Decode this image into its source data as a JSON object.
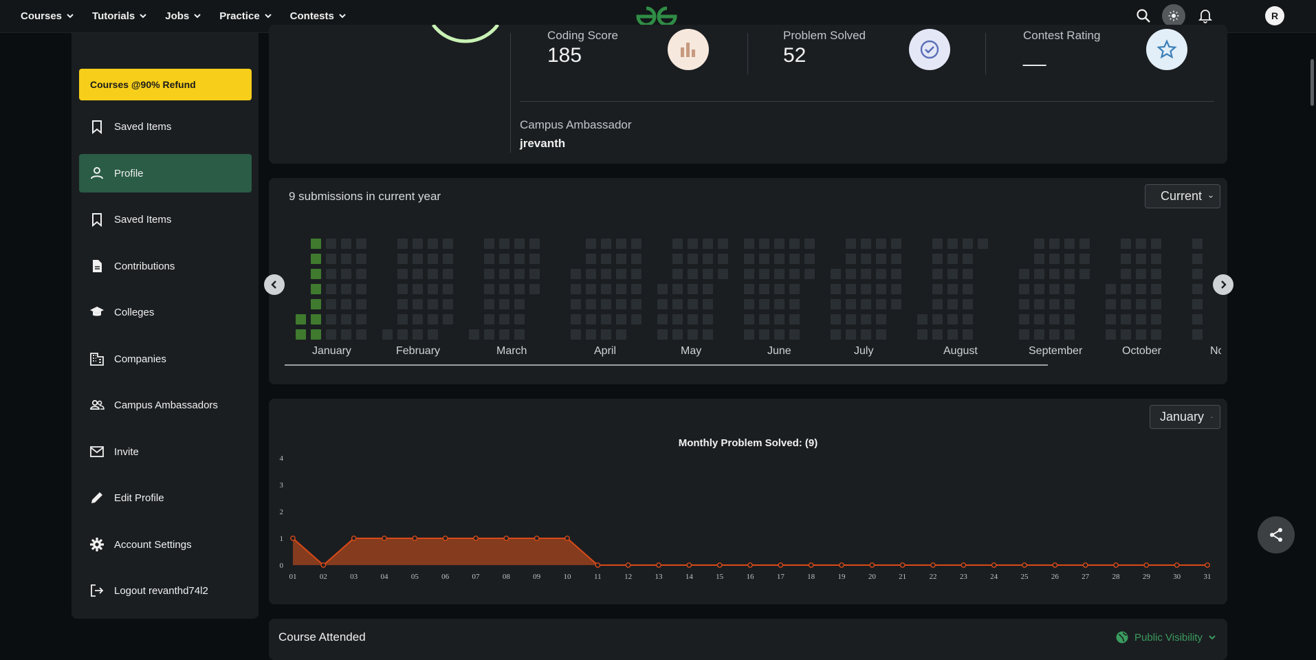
{
  "nav": {
    "items": [
      "Courses",
      "Tutorials",
      "Jobs",
      "Practice",
      "Contests"
    ],
    "avatar_initial": "R"
  },
  "sidebar": {
    "refund_label": "Courses @90% Refund",
    "items": [
      {
        "label": "Saved Items",
        "icon": "bookmark-icon"
      },
      {
        "label": "Profile",
        "icon": "person-icon"
      },
      {
        "label": "Saved Items",
        "icon": "bookmark-icon"
      },
      {
        "label": "Contributions",
        "icon": "document-icon"
      },
      {
        "label": "Colleges",
        "icon": "graduation-cap-icon"
      },
      {
        "label": "Companies",
        "icon": "building-icon"
      },
      {
        "label": "Campus Ambassadors",
        "icon": "group-icon"
      },
      {
        "label": "Invite",
        "icon": "mail-icon"
      },
      {
        "label": "Edit Profile",
        "icon": "pencil-icon"
      },
      {
        "label": "Account Settings",
        "icon": "gear-icon"
      },
      {
        "label": "Logout revanthd74l2",
        "icon": "logout-icon"
      }
    ],
    "active_index": 1
  },
  "stats": {
    "coding_score_label": "Coding Score",
    "coding_score": "185",
    "problems_label": "Problem Solved",
    "problems": "52",
    "contest_label": "Contest Rating",
    "contest": "__",
    "campus_label": "Campus Ambassador",
    "campus_user": "jrevanth"
  },
  "submissions": {
    "title": "9 submissions in current year",
    "year_select": "Current",
    "months": [
      "January",
      "February",
      "March",
      "April",
      "May",
      "June",
      "July",
      "August",
      "September",
      "October",
      "No"
    ],
    "active_color": "#3f7a2e",
    "empty_color": "#2a2f33"
  },
  "monthly": {
    "month_select": "January",
    "title": "Monthly Problem Solved: (9)"
  },
  "chart_data": {
    "type": "area",
    "title": "Monthly Problem Solved: (9)",
    "x": [
      "01",
      "02",
      "03",
      "04",
      "05",
      "06",
      "07",
      "08",
      "09",
      "10",
      "11",
      "12",
      "13",
      "14",
      "15",
      "16",
      "17",
      "18",
      "19",
      "20",
      "21",
      "22",
      "23",
      "24",
      "25",
      "26",
      "27",
      "28",
      "29",
      "30",
      "31"
    ],
    "series": [
      {
        "values": [
          1,
          0,
          1,
          1,
          1,
          1,
          1,
          1,
          1,
          1,
          0,
          0,
          0,
          0,
          0,
          0,
          0,
          0,
          0,
          0,
          0,
          0,
          0,
          0,
          0,
          0,
          0,
          0,
          0,
          0,
          0
        ]
      }
    ],
    "ylim": [
      0,
      4
    ],
    "yticks": [
      0,
      1,
      2,
      3,
      4
    ],
    "color": "#d84a18",
    "grid": false
  },
  "course": {
    "title": "Course Attended",
    "visibility": "Public Visibility"
  }
}
